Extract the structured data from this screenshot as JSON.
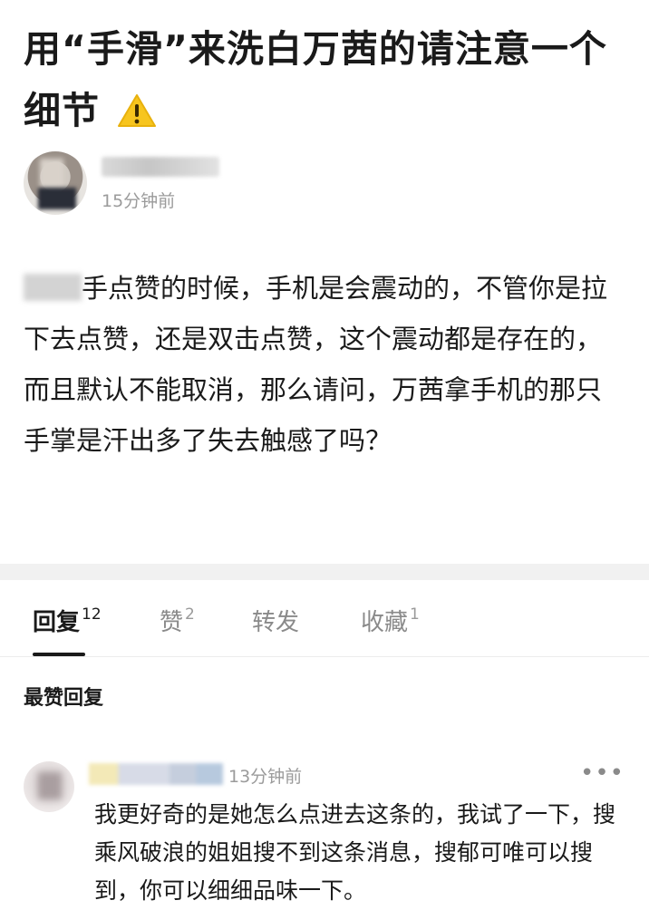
{
  "post": {
    "title": "用“手滑”来洗白万茜的请注意一个细节",
    "warning_icon": "warning-icon",
    "author": {
      "name": "",
      "time": "15分钟前"
    },
    "body": "手点赞的时候，手机是会震动的，不管你是拉下去点赞，还是双击点赞，这个震动都是存在的，而且默认不能取消，那么请问，万茜拿手机的那只手掌是汗出多了失去触感了吗？"
  },
  "tabs": [
    {
      "label": "回复",
      "count": "12",
      "active": true
    },
    {
      "label": "赞",
      "count": "2",
      "active": false
    },
    {
      "label": "转发",
      "count": "",
      "active": false
    },
    {
      "label": "收藏",
      "count": "1",
      "active": false
    }
  ],
  "comments_section": {
    "title": "最赞回复",
    "comments": [
      {
        "name": "",
        "time": "13分钟前",
        "more": "•••",
        "text": "我更好奇的是她怎么点进去这条的，我试了一下，搜乘风破浪的姐姐搜不到这条消息，搜郁可唯可以搜到，你可以细细品味一下。"
      }
    ]
  }
}
